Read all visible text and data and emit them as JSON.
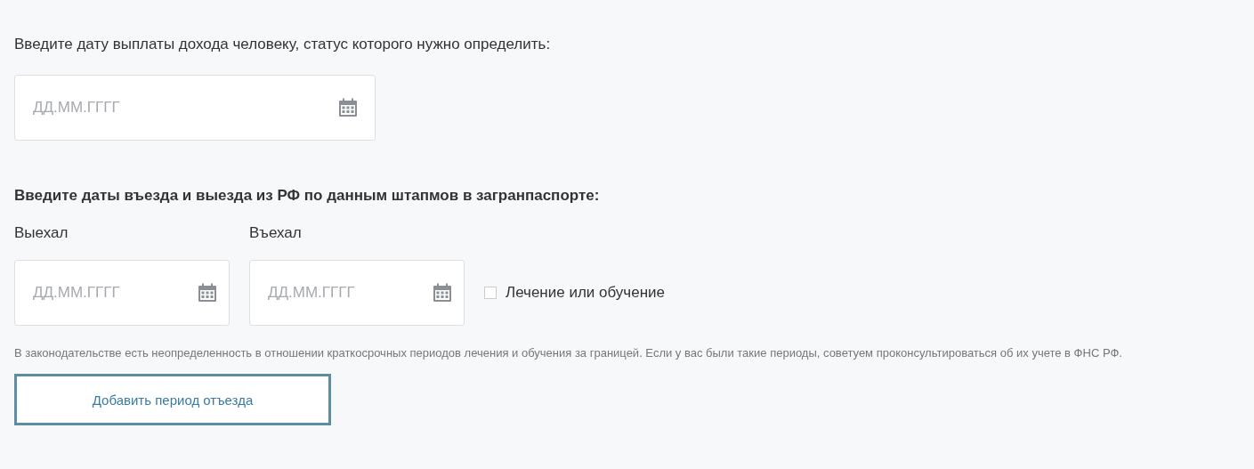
{
  "payment_date": {
    "label": "Введите дату выплаты дохода человеку, статус которого нужно определить:",
    "placeholder": "ДД.ММ.ГГГГ"
  },
  "trips": {
    "heading": "Введите даты въезда и выезда из РФ по данным штапмов в загранпаспорте:",
    "fields": [
      {
        "label": "Выехал",
        "placeholder": "ДД.ММ.ГГГГ"
      },
      {
        "label": "Въехал",
        "placeholder": "ДД.ММ.ГГГГ"
      }
    ],
    "treatment": {
      "label": "Лечение или обучение",
      "checked": false
    }
  },
  "note": "В законодательстве есть неопределенность в отношении краткосрочных периодов лечения и обучения за границей. Если у вас были такие периоды, советуем проконсультироваться об их учете в ФНС РФ.",
  "add_button": "Добавить период отъезда"
}
